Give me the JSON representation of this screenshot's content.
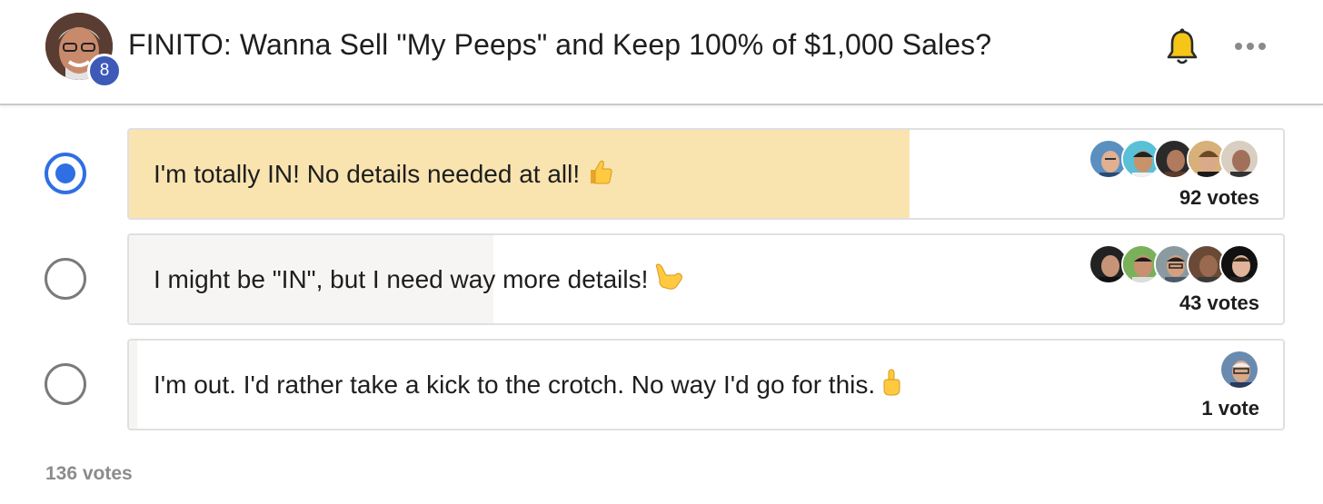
{
  "header": {
    "title": "FINITO: Wanna Sell \"My Peeps\" and Keep 100% of $1,000 Sales?",
    "badge_count": "8",
    "icons": [
      "bell-icon",
      "more-options-icon"
    ]
  },
  "poll": {
    "options": [
      {
        "label": "I'm totally IN! No details needed at all!",
        "emoji": "thumbs-up",
        "votes_label": "92 votes",
        "votes": 92,
        "share": 0.676,
        "selected": true,
        "fill_color": "#f9e4b0",
        "voter_count_shown": 5
      },
      {
        "label": "I might be \"IN\", but I need way more details!",
        "emoji": "call-me-hand",
        "votes_label": "43 votes",
        "votes": 43,
        "share": 0.316,
        "selected": false,
        "fill_color": "#f6f5f3",
        "voter_count_shown": 5
      },
      {
        "label": "I'm out. I'd rather take a kick to the crotch. No way I'd go for this.",
        "emoji": "middle-finger",
        "votes_label": "1 vote",
        "votes": 1,
        "share": 0.007,
        "selected": false,
        "fill_color": "#f6f5f3",
        "voter_count_shown": 1
      }
    ],
    "total_label": "136 votes"
  },
  "colors": {
    "accent": "#2f6fe3",
    "badge": "#3d5ab8",
    "bell": "#f5c518",
    "winner_fill": "#f9e4b0"
  }
}
